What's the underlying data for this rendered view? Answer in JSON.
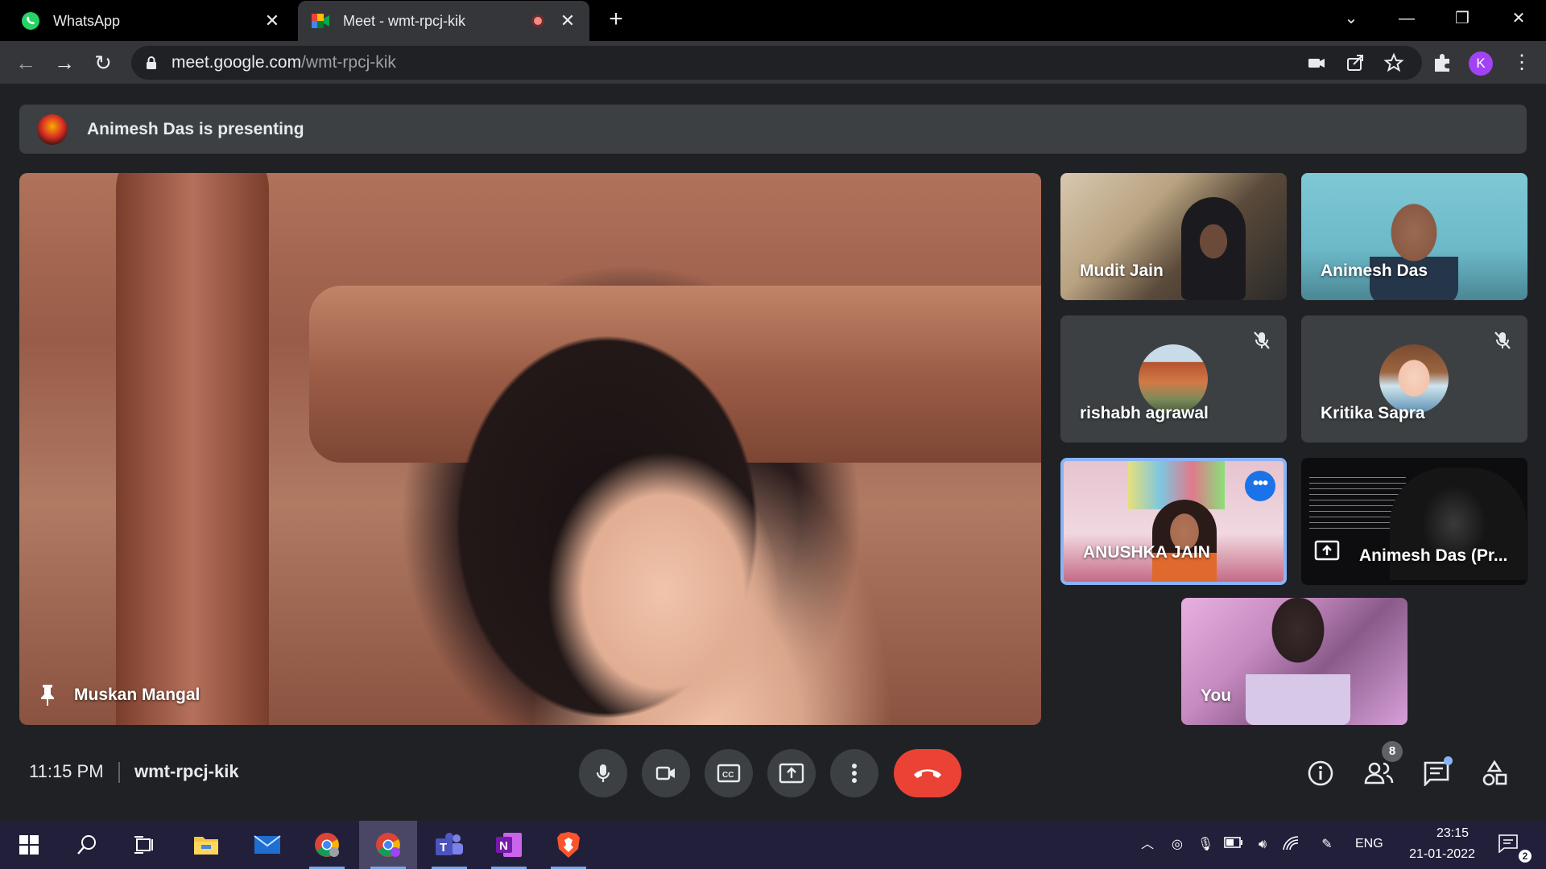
{
  "browser": {
    "tabs": [
      {
        "title": "WhatsApp",
        "icon": "whatsapp-icon",
        "active": false
      },
      {
        "title": "Meet - wmt-rpcj-kik",
        "icon": "meet-icon",
        "active": true,
        "recording": true
      }
    ],
    "url_host": "meet.google.com",
    "url_path": "/wmt-rpcj-kik",
    "profile_initial": "K"
  },
  "meet": {
    "presenting_text": "Animesh Das is presenting",
    "main_tile_name": "Muskan Mangal",
    "participants": [
      {
        "name": "Mudit Jain",
        "muted": false,
        "video": true
      },
      {
        "name": "Animesh Das",
        "muted": false,
        "video": true
      },
      {
        "name": "rishabh agrawal",
        "muted": true,
        "video": false
      },
      {
        "name": "Kritika Sapra",
        "muted": true,
        "video": false
      },
      {
        "name": "ANUSHKA JAIN",
        "muted": false,
        "video": true,
        "speaking": true
      },
      {
        "name": "Animesh Das (Pr...",
        "muted": false,
        "video": true,
        "presentation": true
      },
      {
        "name": "You",
        "muted": false,
        "video": true
      }
    ],
    "time": "11:15 PM",
    "code": "wmt-rpcj-kik",
    "people_count": "8",
    "more_options": "•••"
  },
  "taskbar": {
    "language": "ENG",
    "clock_time": "23:15",
    "clock_date": "21-01-2022",
    "notification_count": "2"
  },
  "colors": {
    "meet_bg": "#202124",
    "tile_bg": "#3c4043",
    "leave_red": "#ea4335",
    "speaking_blue": "#8ab4f8",
    "taskbar": "#221f3b"
  }
}
